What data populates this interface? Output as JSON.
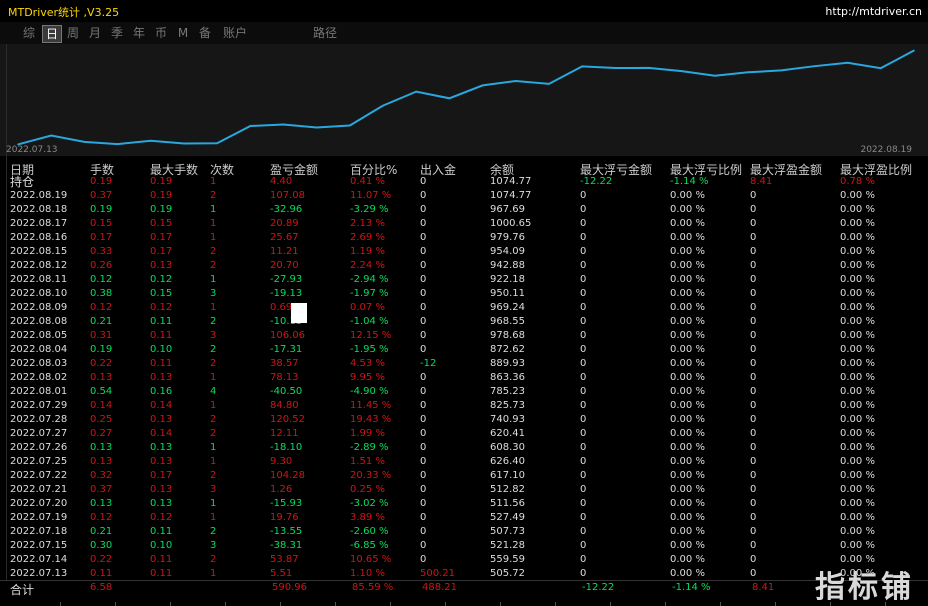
{
  "app": {
    "title": "MTDriver统计 ,V3.25",
    "url": "http://mtdriver.cn"
  },
  "tabs": [
    {
      "label": "综"
    },
    {
      "label": "日",
      "active": true
    },
    {
      "label": "周"
    },
    {
      "label": "月"
    },
    {
      "label": "季"
    },
    {
      "label": "年"
    },
    {
      "label": "币"
    },
    {
      "label": "M"
    },
    {
      "label": "备"
    },
    {
      "label": "账户"
    },
    {
      "label": "路径"
    }
  ],
  "chart": {
    "date_start": "2022.07.13",
    "date_end": "2022.08.19",
    "line_color": "#29a8e0"
  },
  "chart_data": {
    "type": "line",
    "x": [
      "2022.07.13",
      "2022.07.14",
      "2022.07.15",
      "2022.07.18",
      "2022.07.19",
      "2022.07.20",
      "2022.07.21",
      "2022.07.22",
      "2022.07.25",
      "2022.07.26",
      "2022.07.27",
      "2022.07.28",
      "2022.07.29",
      "2022.08.01",
      "2022.08.02",
      "2022.08.03",
      "2022.08.04",
      "2022.08.05",
      "2022.08.08",
      "2022.08.09",
      "2022.08.10",
      "2022.08.11",
      "2022.08.12",
      "2022.08.15",
      "2022.08.16",
      "2022.08.17",
      "2022.08.18",
      "2022.08.19"
    ],
    "values": [
      505.72,
      559.59,
      521.28,
      507.73,
      527.49,
      511.56,
      512.82,
      617.1,
      626.4,
      608.3,
      620.41,
      740.93,
      825.73,
      785.23,
      863.36,
      889.93,
      872.62,
      978.68,
      968.55,
      969.24,
      950.11,
      922.18,
      942.88,
      954.09,
      979.76,
      1000.65,
      967.69,
      1074.77
    ],
    "ylim": [
      490,
      1090
    ]
  },
  "columns": [
    "日期",
    "手数",
    "最大手数",
    "次数",
    "盈亏金额",
    "百分比%",
    "出入金",
    "余额",
    "最大浮亏金额",
    "最大浮亏比例",
    "最大浮盈金额",
    "最大浮盈比例"
  ],
  "holding": {
    "label": "持仓",
    "cells": [
      "0.19",
      "0.19",
      "1",
      "4.40",
      "0.41 %",
      "0",
      "1074.77",
      "-12.22",
      "-1.14 %",
      "8.41",
      "0.78 %"
    ],
    "dirs": [
      "up",
      "up",
      "up",
      "up",
      "up",
      "neu",
      "neu",
      "down",
      "down",
      "up",
      "up"
    ]
  },
  "rows": [
    {
      "cells": [
        "2022.08.19",
        "0.37",
        "0.19",
        "2",
        "107.08",
        "11.07 %",
        "0",
        "1074.77",
        "0",
        "0.00 %",
        "0",
        "0.00 %"
      ],
      "dir": "up"
    },
    {
      "cells": [
        "2022.08.18",
        "0.19",
        "0.19",
        "1",
        "-32.96",
        "-3.29 %",
        "0",
        "967.69",
        "0",
        "0.00 %",
        "0",
        "0.00 %"
      ],
      "dir": "down"
    },
    {
      "cells": [
        "2022.08.17",
        "0.15",
        "0.15",
        "1",
        "20.89",
        "2.13 %",
        "0",
        "1000.65",
        "0",
        "0.00 %",
        "0",
        "0.00 %"
      ],
      "dir": "up"
    },
    {
      "cells": [
        "2022.08.16",
        "0.17",
        "0.17",
        "1",
        "25.67",
        "2.69 %",
        "0",
        "979.76",
        "0",
        "0.00 %",
        "0",
        "0.00 %"
      ],
      "dir": "up"
    },
    {
      "cells": [
        "2022.08.15",
        "0.33",
        "0.17",
        "2",
        "11.21",
        "1.19 %",
        "0",
        "954.09",
        "0",
        "0.00 %",
        "0",
        "0.00 %"
      ],
      "dir": "up"
    },
    {
      "cells": [
        "2022.08.12",
        "0.26",
        "0.13",
        "2",
        "20.70",
        "2.24 %",
        "0",
        "942.88",
        "0",
        "0.00 %",
        "0",
        "0.00 %"
      ],
      "dir": "up"
    },
    {
      "cells": [
        "2022.08.11",
        "0.12",
        "0.12",
        "1",
        "-27.93",
        "-2.94 %",
        "0",
        "922.18",
        "0",
        "0.00 %",
        "0",
        "0.00 %"
      ],
      "dir": "down"
    },
    {
      "cells": [
        "2022.08.10",
        "0.38",
        "0.15",
        "3",
        "-19.13",
        "-1.97 %",
        "0",
        "950.11",
        "0",
        "0.00 %",
        "0",
        "0.00 %"
      ],
      "dir": "down"
    },
    {
      "cells": [
        "2022.08.09",
        "0.12",
        "0.12",
        "1",
        "0.69",
        "0.07 %",
        "0",
        "969.24",
        "0",
        "0.00 %",
        "0",
        "0.00 %"
      ],
      "dir": "up"
    },
    {
      "cells": [
        "2022.08.08",
        "0.21",
        "0.11",
        "2",
        "-10.13",
        "-1.04 %",
        "0",
        "968.55",
        "0",
        "0.00 %",
        "0",
        "0.00 %"
      ],
      "dir": "down"
    },
    {
      "cells": [
        "2022.08.05",
        "0.31",
        "0.11",
        "3",
        "106.06",
        "12.15 %",
        "0",
        "978.68",
        "0",
        "0.00 %",
        "0",
        "0.00 %"
      ],
      "dir": "up"
    },
    {
      "cells": [
        "2022.08.04",
        "0.19",
        "0.10",
        "2",
        "-17.31",
        "-1.95 %",
        "0",
        "872.62",
        "0",
        "0.00 %",
        "0",
        "0.00 %"
      ],
      "dir": "down"
    },
    {
      "cells": [
        "2022.08.03",
        "0.22",
        "0.11",
        "2",
        "38.57",
        "4.53 %",
        "-12",
        "889.93",
        "0",
        "0.00 %",
        "0",
        "0.00 %"
      ],
      "dir": "up",
      "cash_dir": "down"
    },
    {
      "cells": [
        "2022.08.02",
        "0.13",
        "0.13",
        "1",
        "78.13",
        "9.95 %",
        "0",
        "863.36",
        "0",
        "0.00 %",
        "0",
        "0.00 %"
      ],
      "dir": "up"
    },
    {
      "cells": [
        "2022.08.01",
        "0.54",
        "0.16",
        "4",
        "-40.50",
        "-4.90 %",
        "0",
        "785.23",
        "0",
        "0.00 %",
        "0",
        "0.00 %"
      ],
      "dir": "down"
    },
    {
      "cells": [
        "2022.07.29",
        "0.14",
        "0.14",
        "1",
        "84.80",
        "11.45 %",
        "0",
        "825.73",
        "0",
        "0.00 %",
        "0",
        "0.00 %"
      ],
      "dir": "up"
    },
    {
      "cells": [
        "2022.07.28",
        "0.25",
        "0.13",
        "2",
        "120.52",
        "19.43 %",
        "0",
        "740.93",
        "0",
        "0.00 %",
        "0",
        "0.00 %"
      ],
      "dir": "up"
    },
    {
      "cells": [
        "2022.07.27",
        "0.27",
        "0.14",
        "2",
        "12.11",
        "1.99 %",
        "0",
        "620.41",
        "0",
        "0.00 %",
        "0",
        "0.00 %"
      ],
      "dir": "up"
    },
    {
      "cells": [
        "2022.07.26",
        "0.13",
        "0.13",
        "1",
        "-18.10",
        "-2.89 %",
        "0",
        "608.30",
        "0",
        "0.00 %",
        "0",
        "0.00 %"
      ],
      "dir": "down"
    },
    {
      "cells": [
        "2022.07.25",
        "0.13",
        "0.13",
        "1",
        "9.30",
        "1.51 %",
        "0",
        "626.40",
        "0",
        "0.00 %",
        "0",
        "0.00 %"
      ],
      "dir": "up"
    },
    {
      "cells": [
        "2022.07.22",
        "0.32",
        "0.17",
        "2",
        "104.28",
        "20.33 %",
        "0",
        "617.10",
        "0",
        "0.00 %",
        "0",
        "0.00 %"
      ],
      "dir": "up"
    },
    {
      "cells": [
        "2022.07.21",
        "0.37",
        "0.13",
        "3",
        "1.26",
        "0.25 %",
        "0",
        "512.82",
        "0",
        "0.00 %",
        "0",
        "0.00 %"
      ],
      "dir": "up"
    },
    {
      "cells": [
        "2022.07.20",
        "0.13",
        "0.13",
        "1",
        "-15.93",
        "-3.02 %",
        "0",
        "511.56",
        "0",
        "0.00 %",
        "0",
        "0.00 %"
      ],
      "dir": "down"
    },
    {
      "cells": [
        "2022.07.19",
        "0.12",
        "0.12",
        "1",
        "19.76",
        "3.89 %",
        "0",
        "527.49",
        "0",
        "0.00 %",
        "0",
        "0.00 %"
      ],
      "dir": "up"
    },
    {
      "cells": [
        "2022.07.18",
        "0.21",
        "0.11",
        "2",
        "-13.55",
        "-2.60 %",
        "0",
        "507.73",
        "0",
        "0.00 %",
        "0",
        "0.00 %"
      ],
      "dir": "down"
    },
    {
      "cells": [
        "2022.07.15",
        "0.30",
        "0.10",
        "3",
        "-38.31",
        "-6.85 %",
        "0",
        "521.28",
        "0",
        "0.00 %",
        "0",
        "0.00 %"
      ],
      "dir": "down"
    },
    {
      "cells": [
        "2022.07.14",
        "0.22",
        "0.11",
        "2",
        "53.87",
        "10.65 %",
        "0",
        "559.59",
        "0",
        "0.00 %",
        "0",
        "0.00 %"
      ],
      "dir": "up"
    },
    {
      "cells": [
        "2022.07.13",
        "0.11",
        "0.11",
        "1",
        "5.51",
        "1.10 %",
        "500.21",
        "505.72",
        "0",
        "0.00 %",
        "0",
        "0.00 %"
      ],
      "dir": "up",
      "cash_dir": "up"
    }
  ],
  "total": {
    "label": "合计",
    "lots": "6.58",
    "pl": "590.96",
    "pct": "85.59 %",
    "cash": "488.21",
    "float_loss": "-12.22",
    "float_loss_pct": "-1.14 %",
    "float_profit": "8.41"
  },
  "watermark": "指标铺"
}
